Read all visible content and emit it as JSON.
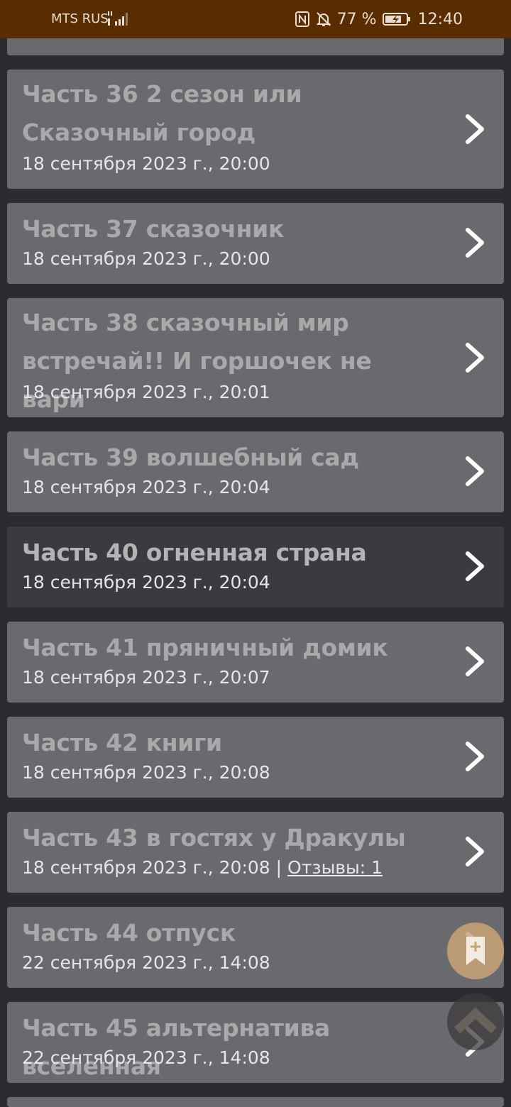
{
  "status_bar": {
    "carrier": "MTS RUS",
    "battery": "77 %",
    "time": "12:40"
  },
  "chapters": [
    {
      "title": "Часть 36 2 сезон или Сказочный город",
      "date": "18 сентября 2023 г., 20:00"
    },
    {
      "title": "Часть 37 сказочник",
      "date": "18 сентября 2023 г., 20:00"
    },
    {
      "title": "Часть 38 сказочный мир встречай!! И горшочек не вари",
      "date": "18 сентября 2023 г., 20:01"
    },
    {
      "title": "Часть 39 волшебный сад",
      "date": "18 сентября 2023 г., 20:04"
    },
    {
      "title": "Часть 40 огненная страна",
      "date": "18 сентября 2023 г., 20:04"
    },
    {
      "title": "Часть 41 пряничный домик",
      "date": "18 сентября 2023 г., 20:07"
    },
    {
      "title": "Часть 42 книги",
      "date": "18 сентября 2023 г., 20:08"
    },
    {
      "title": "Часть 43 в гостях у Дракулы",
      "date": "18 сентября 2023 г., 20:08",
      "separator": " | ",
      "reviews": "Отзывы: 1"
    },
    {
      "title": "Часть 44 отпуск",
      "date": "22 сентября 2023 г., 14:08"
    },
    {
      "title": "Часть 45 альтернатива вселенная",
      "date": "22 сентября 2023 г., 14:08"
    }
  ],
  "colors": {
    "status_bar": "#5a2d00",
    "background": "#2c2b2f",
    "card": "#6a696d",
    "card_active": "#3b3a3e",
    "bookmark_fab": "#c8a578"
  },
  "icons": {
    "chevron": "chevron-right-icon",
    "bookmark_fab": "bookmark-add-icon",
    "scroll_top_fab": "chevron-up-icon"
  }
}
